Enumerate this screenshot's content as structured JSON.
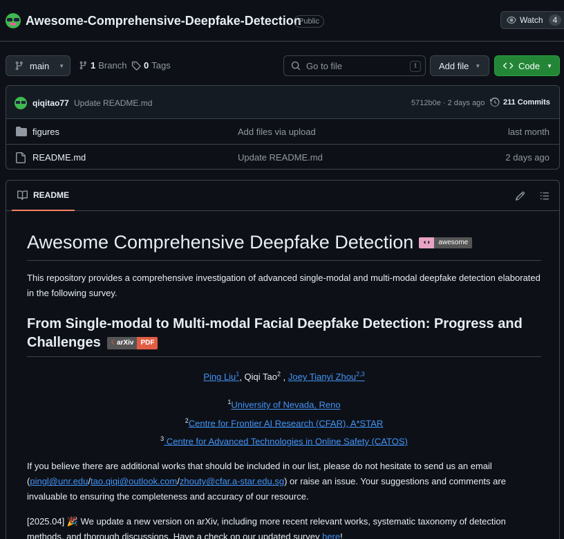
{
  "repo": {
    "name": "Awesome-Comprehensive-Deepfake-Detection",
    "visibility": "Public",
    "watch_label": "Watch",
    "watch_count": "4"
  },
  "toolbar": {
    "branch": "main",
    "branch_count": "1",
    "branch_label": "Branch",
    "tag_count": "0",
    "tag_label": "Tags",
    "search_placeholder": "Go to file",
    "search_shortcut": "t",
    "add_file_label": "Add file",
    "code_label": "Code"
  },
  "latest_commit": {
    "author": "qiqitao77",
    "message": "Update README.md",
    "meta": "5712b0e · 2 days ago",
    "commits_label": "211 Commits"
  },
  "files": [
    {
      "name": "figures",
      "type": "folder",
      "commit": "Add files via upload",
      "date": "last month"
    },
    {
      "name": "README.md",
      "type": "file",
      "commit": "Update README.md",
      "date": "2 days ago"
    }
  ],
  "readme": {
    "tab_label": "README",
    "title": "Awesome Comprehensive Deepfake Detection",
    "badge_awesome": "awesome",
    "intro": "This repository provides a comprehensive investigation of advanced single-modal and multi-modal deepfake detection elaborated in the following survey.",
    "paper_title": "From Single-modal to Multi-modal Facial Deepfake Detection: Progress and Challenges",
    "badge_arxiv_left": "arXiv",
    "badge_arxiv_right": "PDF",
    "authors": {
      "a1_name": "Ping Liu",
      "a1_sup": "1",
      "sep1": ", ",
      "a2_name": "Qiqi Tao",
      "a2_sup": "2",
      "sep2": " , ",
      "a3_name": "Joey Tianyi Zhou",
      "a3_sup": "2,3"
    },
    "affiliations": [
      {
        "sup": "1",
        "name": "University of Nevada, Reno"
      },
      {
        "sup": "2",
        "name": "Centre for Frontier AI Research (CFAR), A*STAR"
      },
      {
        "sup": "3",
        "name": " Centre for Advanced Technologies in Online Safety (CATOS)"
      }
    ],
    "contact": {
      "pre": "If you believe there are additional works that should be included in our list, please do not hesitate to send us an email (",
      "email1": "pingl@unr.edu",
      "slash": "/",
      "email2": "tao.qiqi@outlook.com",
      "email3": "zhouty@cfar.a-star.edu.sg",
      "post": ") or raise an issue. Your suggestions and comments are invaluable to ensuring the completeness and accuracy of our resource."
    },
    "news": {
      "date": "[2025.04]",
      "emoji": "🎉",
      "text": " We update a new version on arXiv, including more recent relevant works, systematic taxonomy of detection methods, and thorough discussions. Have a check on our updated survey ",
      "link": "here",
      "end": "!"
    }
  }
}
